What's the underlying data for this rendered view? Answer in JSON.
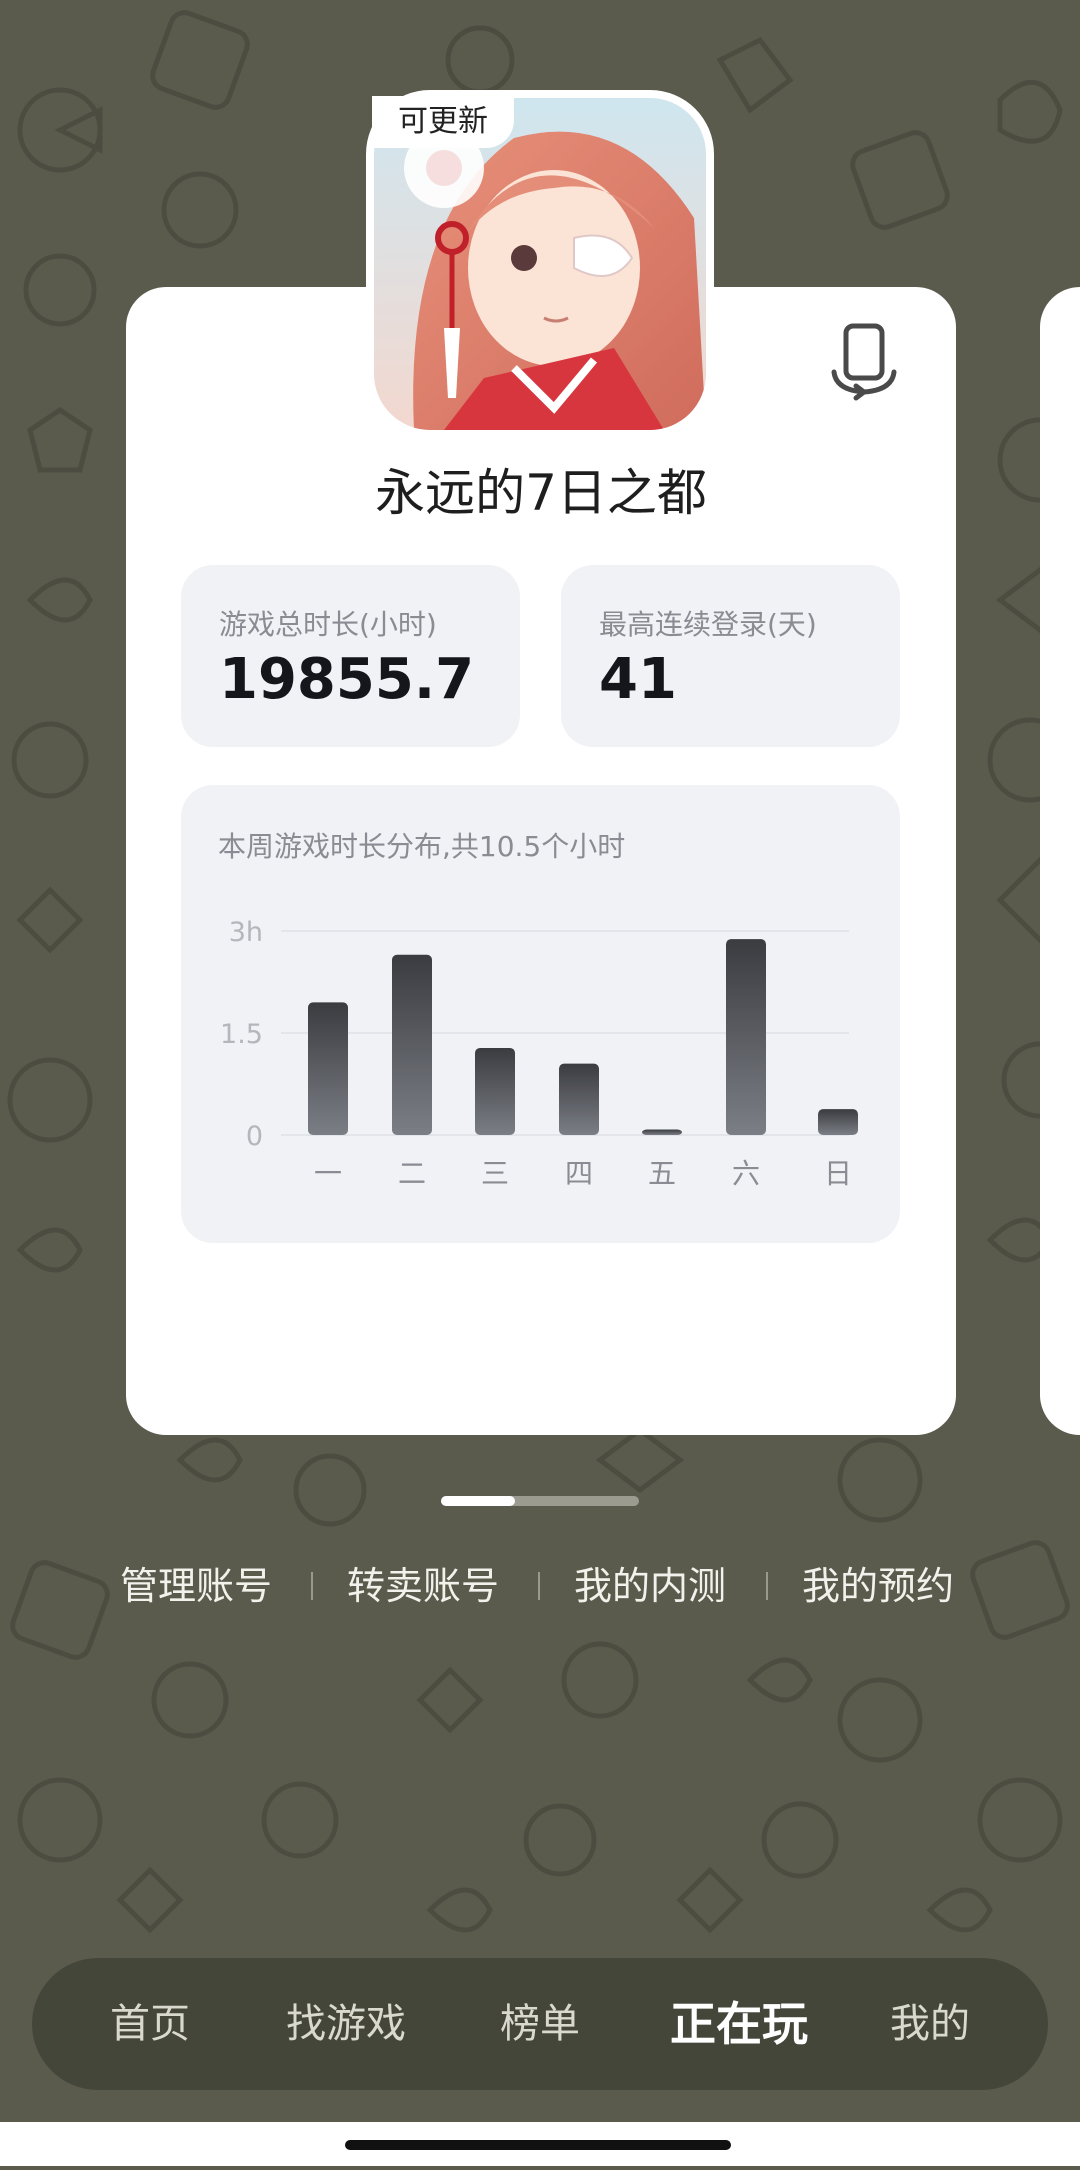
{
  "card": {
    "badge": "可更新",
    "title": "永远的7日之都",
    "stats": [
      {
        "label": "游戏总时长(小时)",
        "value": "19855.7"
      },
      {
        "label": "最高连续登录(天)",
        "value": "41"
      }
    ]
  },
  "chart_data": {
    "type": "bar",
    "title": "本周游戏时长分布,共10.5个小时",
    "categories": [
      "一",
      "二",
      "三",
      "四",
      "五",
      "六",
      "日"
    ],
    "values": [
      1.95,
      2.65,
      1.28,
      1.05,
      0.08,
      2.88,
      0.38
    ],
    "ylim": [
      0,
      3
    ],
    "yticks": [
      "0",
      "1.5",
      "3h"
    ],
    "ytick_values": [
      0,
      1.5,
      3
    ],
    "grid": true,
    "bar_gradient": [
      "#3a3c40",
      "#7b7e85"
    ]
  },
  "links": [
    "管理账号",
    "转卖账号",
    "我的内测",
    "我的预约"
  ],
  "nav": {
    "items": [
      "首页",
      "找游戏",
      "榜单",
      "正在玩",
      "我的"
    ],
    "active_index": 3
  },
  "icons": {
    "switch": "phone-switch-icon"
  },
  "colors": {
    "background": "#5b5b4d",
    "card": "#ffffff",
    "stat_bg": "#f1f2f6"
  }
}
